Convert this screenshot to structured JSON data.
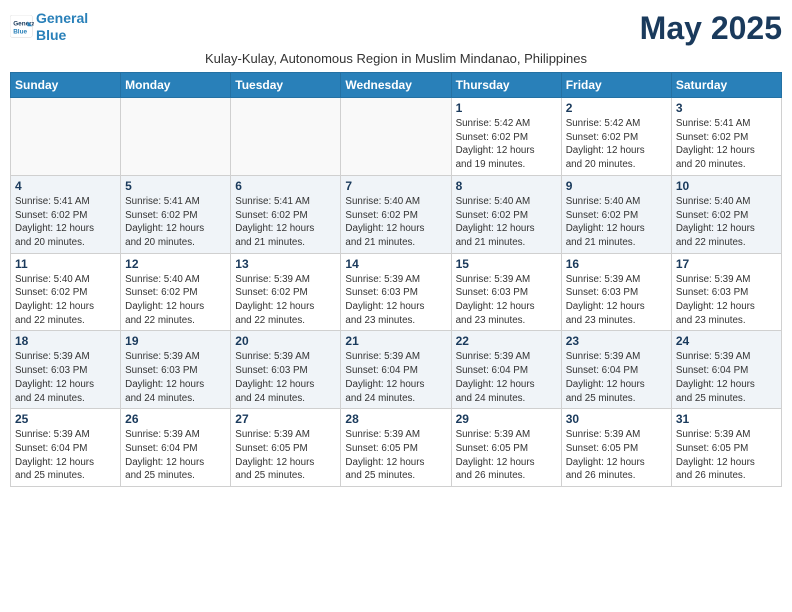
{
  "header": {
    "logo_line1": "General",
    "logo_line2": "Blue",
    "month_title": "May 2025",
    "subtitle": "Kulay-Kulay, Autonomous Region in Muslim Mindanao, Philippines"
  },
  "weekdays": [
    "Sunday",
    "Monday",
    "Tuesday",
    "Wednesday",
    "Thursday",
    "Friday",
    "Saturday"
  ],
  "weeks": [
    [
      {
        "day": "",
        "info": ""
      },
      {
        "day": "",
        "info": ""
      },
      {
        "day": "",
        "info": ""
      },
      {
        "day": "",
        "info": ""
      },
      {
        "day": "1",
        "info": "Sunrise: 5:42 AM\nSunset: 6:02 PM\nDaylight: 12 hours\nand 19 minutes."
      },
      {
        "day": "2",
        "info": "Sunrise: 5:42 AM\nSunset: 6:02 PM\nDaylight: 12 hours\nand 20 minutes."
      },
      {
        "day": "3",
        "info": "Sunrise: 5:41 AM\nSunset: 6:02 PM\nDaylight: 12 hours\nand 20 minutes."
      }
    ],
    [
      {
        "day": "4",
        "info": "Sunrise: 5:41 AM\nSunset: 6:02 PM\nDaylight: 12 hours\nand 20 minutes."
      },
      {
        "day": "5",
        "info": "Sunrise: 5:41 AM\nSunset: 6:02 PM\nDaylight: 12 hours\nand 20 minutes."
      },
      {
        "day": "6",
        "info": "Sunrise: 5:41 AM\nSunset: 6:02 PM\nDaylight: 12 hours\nand 21 minutes."
      },
      {
        "day": "7",
        "info": "Sunrise: 5:40 AM\nSunset: 6:02 PM\nDaylight: 12 hours\nand 21 minutes."
      },
      {
        "day": "8",
        "info": "Sunrise: 5:40 AM\nSunset: 6:02 PM\nDaylight: 12 hours\nand 21 minutes."
      },
      {
        "day": "9",
        "info": "Sunrise: 5:40 AM\nSunset: 6:02 PM\nDaylight: 12 hours\nand 21 minutes."
      },
      {
        "day": "10",
        "info": "Sunrise: 5:40 AM\nSunset: 6:02 PM\nDaylight: 12 hours\nand 22 minutes."
      }
    ],
    [
      {
        "day": "11",
        "info": "Sunrise: 5:40 AM\nSunset: 6:02 PM\nDaylight: 12 hours\nand 22 minutes."
      },
      {
        "day": "12",
        "info": "Sunrise: 5:40 AM\nSunset: 6:02 PM\nDaylight: 12 hours\nand 22 minutes."
      },
      {
        "day": "13",
        "info": "Sunrise: 5:39 AM\nSunset: 6:02 PM\nDaylight: 12 hours\nand 22 minutes."
      },
      {
        "day": "14",
        "info": "Sunrise: 5:39 AM\nSunset: 6:03 PM\nDaylight: 12 hours\nand 23 minutes."
      },
      {
        "day": "15",
        "info": "Sunrise: 5:39 AM\nSunset: 6:03 PM\nDaylight: 12 hours\nand 23 minutes."
      },
      {
        "day": "16",
        "info": "Sunrise: 5:39 AM\nSunset: 6:03 PM\nDaylight: 12 hours\nand 23 minutes."
      },
      {
        "day": "17",
        "info": "Sunrise: 5:39 AM\nSunset: 6:03 PM\nDaylight: 12 hours\nand 23 minutes."
      }
    ],
    [
      {
        "day": "18",
        "info": "Sunrise: 5:39 AM\nSunset: 6:03 PM\nDaylight: 12 hours\nand 24 minutes."
      },
      {
        "day": "19",
        "info": "Sunrise: 5:39 AM\nSunset: 6:03 PM\nDaylight: 12 hours\nand 24 minutes."
      },
      {
        "day": "20",
        "info": "Sunrise: 5:39 AM\nSunset: 6:03 PM\nDaylight: 12 hours\nand 24 minutes."
      },
      {
        "day": "21",
        "info": "Sunrise: 5:39 AM\nSunset: 6:04 PM\nDaylight: 12 hours\nand 24 minutes."
      },
      {
        "day": "22",
        "info": "Sunrise: 5:39 AM\nSunset: 6:04 PM\nDaylight: 12 hours\nand 24 minutes."
      },
      {
        "day": "23",
        "info": "Sunrise: 5:39 AM\nSunset: 6:04 PM\nDaylight: 12 hours\nand 25 minutes."
      },
      {
        "day": "24",
        "info": "Sunrise: 5:39 AM\nSunset: 6:04 PM\nDaylight: 12 hours\nand 25 minutes."
      }
    ],
    [
      {
        "day": "25",
        "info": "Sunrise: 5:39 AM\nSunset: 6:04 PM\nDaylight: 12 hours\nand 25 minutes."
      },
      {
        "day": "26",
        "info": "Sunrise: 5:39 AM\nSunset: 6:04 PM\nDaylight: 12 hours\nand 25 minutes."
      },
      {
        "day": "27",
        "info": "Sunrise: 5:39 AM\nSunset: 6:05 PM\nDaylight: 12 hours\nand 25 minutes."
      },
      {
        "day": "28",
        "info": "Sunrise: 5:39 AM\nSunset: 6:05 PM\nDaylight: 12 hours\nand 25 minutes."
      },
      {
        "day": "29",
        "info": "Sunrise: 5:39 AM\nSunset: 6:05 PM\nDaylight: 12 hours\nand 26 minutes."
      },
      {
        "day": "30",
        "info": "Sunrise: 5:39 AM\nSunset: 6:05 PM\nDaylight: 12 hours\nand 26 minutes."
      },
      {
        "day": "31",
        "info": "Sunrise: 5:39 AM\nSunset: 6:05 PM\nDaylight: 12 hours\nand 26 minutes."
      }
    ]
  ]
}
